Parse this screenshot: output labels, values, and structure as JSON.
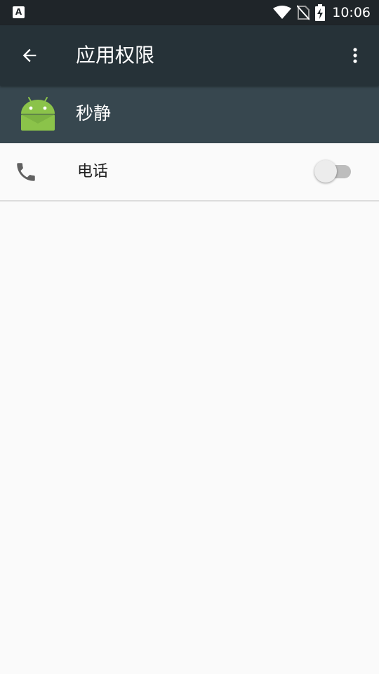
{
  "status_bar": {
    "left_icon": "A",
    "left_icon_name": "accessibility-icon",
    "icons": [
      "wifi-icon",
      "no-sim-icon",
      "battery-charging-icon"
    ],
    "time": "10:06"
  },
  "toolbar": {
    "title": "应用权限",
    "back_icon": "arrow-left-icon",
    "menu_icon": "more-vert-icon"
  },
  "app": {
    "name": "秒静",
    "icon": "android-robot-icon"
  },
  "permissions": [
    {
      "label": "电话",
      "icon": "phone-icon",
      "enabled": false
    }
  ],
  "colors": {
    "status_bar": "#1f2529",
    "toolbar": "#263238",
    "app_header": "#37474f",
    "background": "#fafafa",
    "android_green": "#8bc34a"
  }
}
